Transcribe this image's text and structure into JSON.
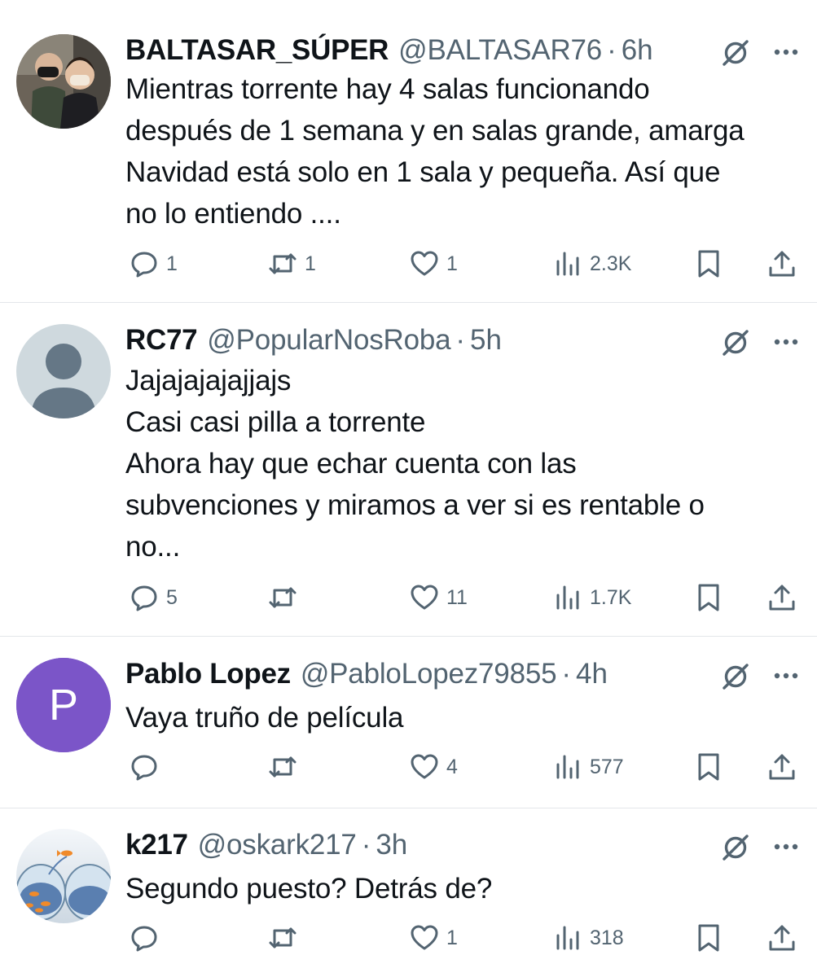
{
  "tweets": [
    {
      "name": "BALTASAR_SÚPER",
      "handle": "@BALTASAR76",
      "sep": "·",
      "time": "6h",
      "text": "Mientras torrente hay 4 salas funcionando\ndespués de 1 semana y en salas grande, amarga\nNavidad está solo en 1 sala y pequeña. Así que\nno lo entiendo ....",
      "avatar": "photo",
      "replies": "1",
      "retweets": "1",
      "likes": "1",
      "views": "2.3K"
    },
    {
      "name": "RC77",
      "handle": "@PopularNosRoba",
      "sep": "·",
      "time": "5h",
      "text": "Jajajajajajjajs\nCasi casi pilla a torrente\nAhora hay que echar cuenta con las\nsubvenciones y miramos a ver si es rentable o\nno...",
      "avatar": "default",
      "replies": "5",
      "retweets": "",
      "likes": "11",
      "views": "1.7K"
    },
    {
      "name": "Pablo Lopez",
      "handle": "@PabloLopez79855",
      "sep": "·",
      "time": "4h",
      "text": "Vaya truño de película",
      "avatar": "letter",
      "avatar_letter": "P",
      "avatar_color": "#7b55c8",
      "replies": "",
      "retweets": "",
      "likes": "4",
      "views": "577"
    },
    {
      "name": "k217",
      "handle": "@oskark217",
      "sep": "·",
      "time": "3h",
      "text": "Segundo puesto? Detrás de?",
      "avatar": "fishbowl",
      "replies": "",
      "retweets": "",
      "likes": "1",
      "views": "318"
    }
  ],
  "icons": {
    "reply": "reply-icon",
    "retweet": "retweet-icon",
    "like": "heart-icon",
    "views": "views-icon",
    "bookmark": "bookmark-icon",
    "share": "share-icon",
    "grok": "grok-icon",
    "more": "more-icon"
  },
  "colors": {
    "text": "#0f1419",
    "secondary": "#536471",
    "divider": "#e3e6ea",
    "default_avatar_bg": "#cfd9de",
    "default_avatar_fg": "#657786"
  }
}
